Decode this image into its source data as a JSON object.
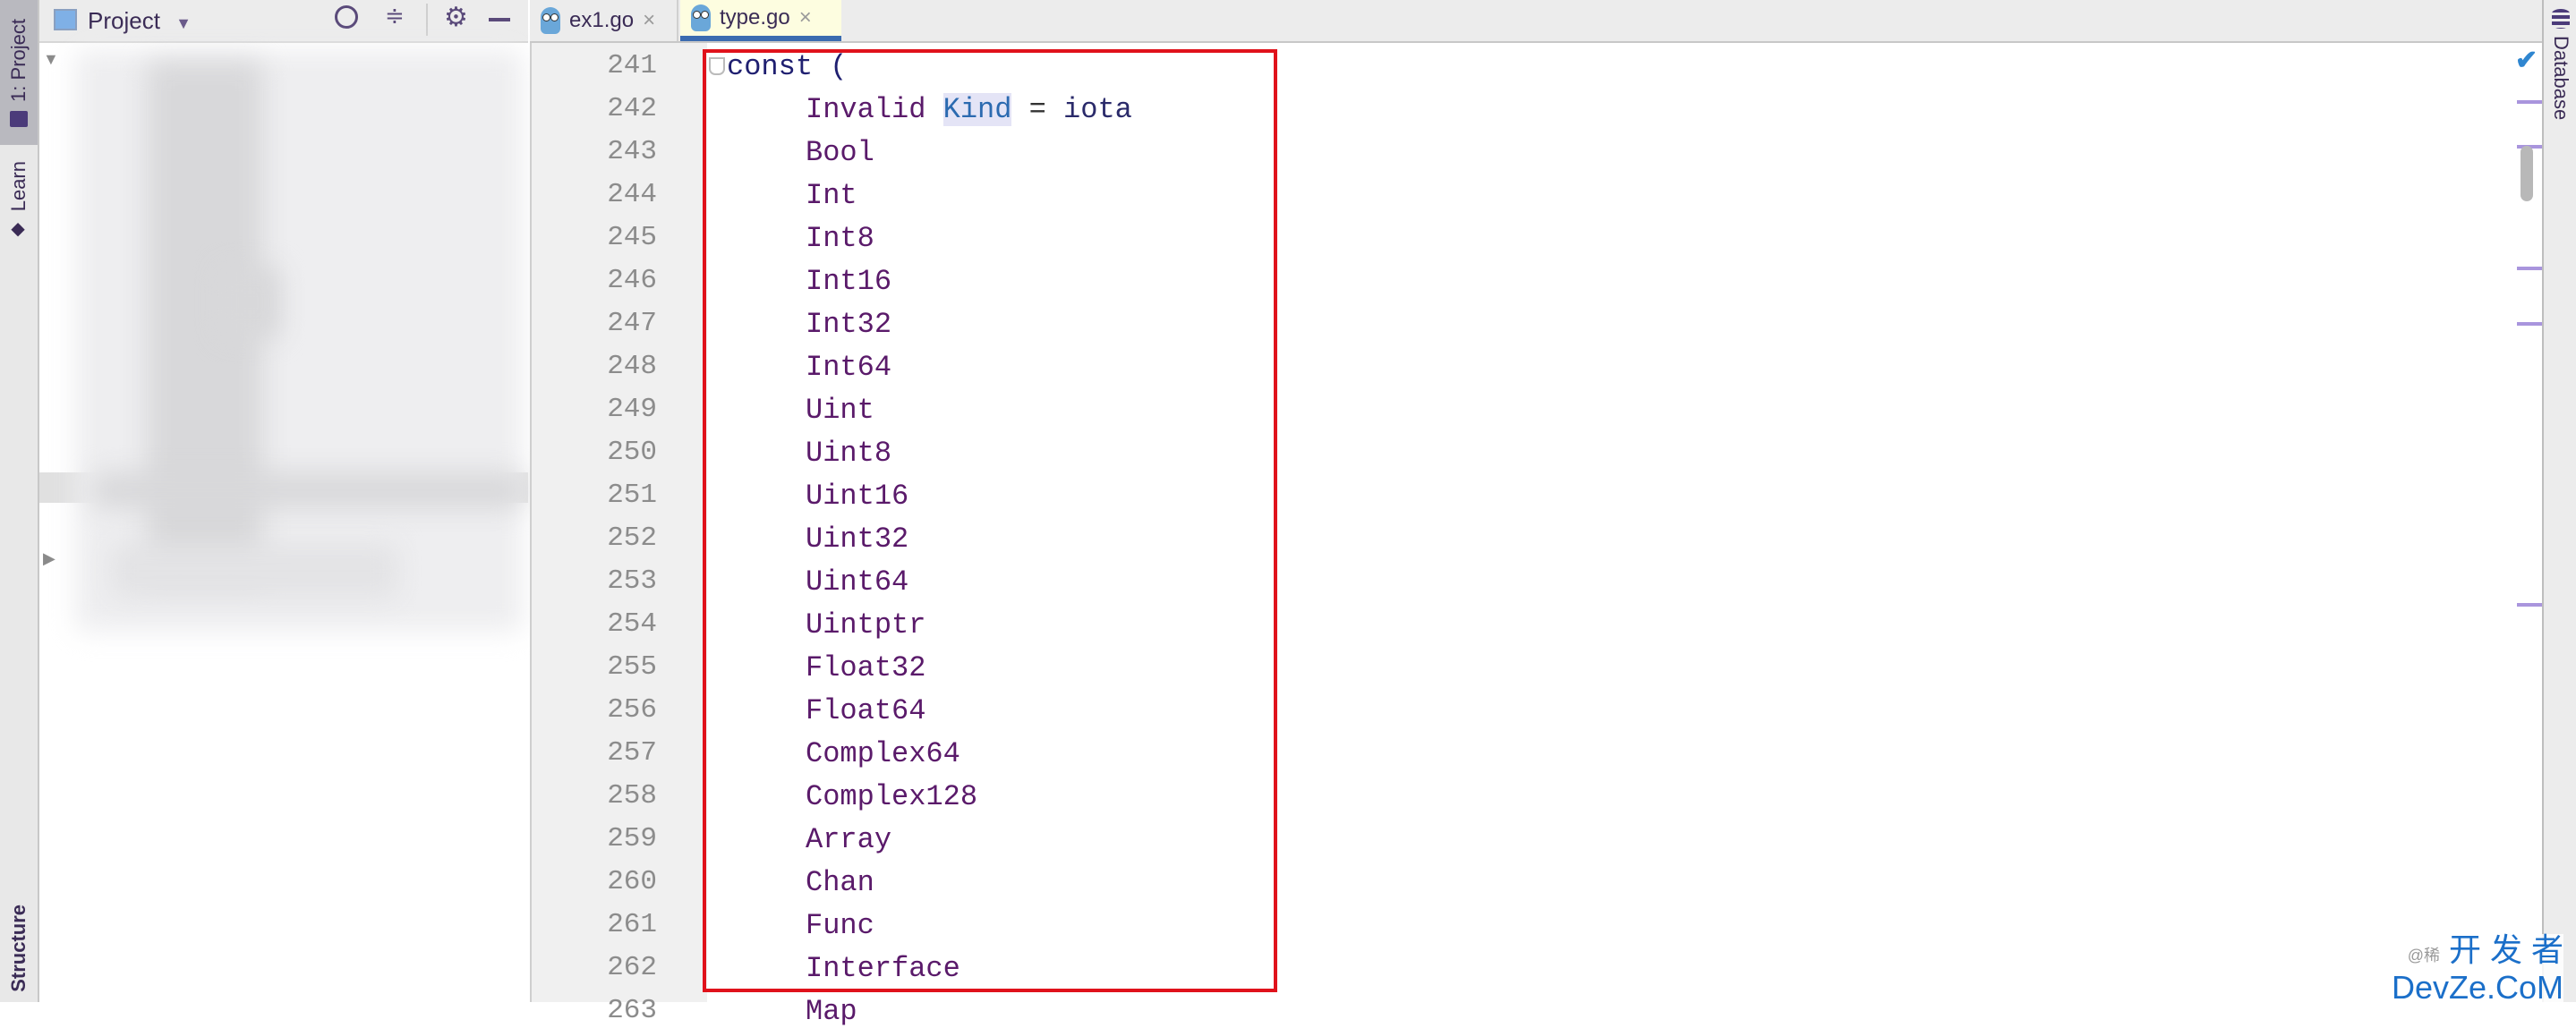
{
  "left_toolstrip": {
    "tabs": [
      {
        "label": "1: Project",
        "icon": "folder-icon",
        "active": true
      },
      {
        "label": "Learn",
        "icon": "graduation-cap-icon",
        "active": false
      },
      {
        "label": "Structure",
        "icon": "",
        "active": false
      }
    ]
  },
  "project_panel": {
    "title": "Project",
    "actions": [
      "locate-icon",
      "collapse-all-icon",
      "gear-icon",
      "minimize-icon"
    ],
    "content_blurred": true
  },
  "editor_tabs": [
    {
      "label": "ex1.go",
      "active": false
    },
    {
      "label": "type.go",
      "active": true
    }
  ],
  "editor": {
    "lines": [
      {
        "no": "241",
        "parts": [
          {
            "t": "const (",
            "c": "kw"
          }
        ],
        "indent": 0,
        "fold": true
      },
      {
        "no": "242",
        "parts": [
          {
            "t": "Invalid ",
            "c": ""
          },
          {
            "t": "Kind",
            "c": "tp"
          },
          {
            "t": " = ",
            "c": "op"
          },
          {
            "t": "iota",
            "c": "id"
          }
        ],
        "indent": 1
      },
      {
        "no": "243",
        "parts": [
          {
            "t": "Bool",
            "c": ""
          }
        ],
        "indent": 1
      },
      {
        "no": "244",
        "parts": [
          {
            "t": "Int",
            "c": ""
          }
        ],
        "indent": 1
      },
      {
        "no": "245",
        "parts": [
          {
            "t": "Int8",
            "c": ""
          }
        ],
        "indent": 1
      },
      {
        "no": "246",
        "parts": [
          {
            "t": "Int16",
            "c": ""
          }
        ],
        "indent": 1
      },
      {
        "no": "247",
        "parts": [
          {
            "t": "Int32",
            "c": ""
          }
        ],
        "indent": 1
      },
      {
        "no": "248",
        "parts": [
          {
            "t": "Int64",
            "c": ""
          }
        ],
        "indent": 1
      },
      {
        "no": "249",
        "parts": [
          {
            "t": "Uint",
            "c": ""
          }
        ],
        "indent": 1
      },
      {
        "no": "250",
        "parts": [
          {
            "t": "Uint8",
            "c": ""
          }
        ],
        "indent": 1
      },
      {
        "no": "251",
        "parts": [
          {
            "t": "Uint16",
            "c": ""
          }
        ],
        "indent": 1
      },
      {
        "no": "252",
        "parts": [
          {
            "t": "Uint32",
            "c": ""
          }
        ],
        "indent": 1
      },
      {
        "no": "253",
        "parts": [
          {
            "t": "Uint64",
            "c": ""
          }
        ],
        "indent": 1
      },
      {
        "no": "254",
        "parts": [
          {
            "t": "Uintptr",
            "c": ""
          }
        ],
        "indent": 1
      },
      {
        "no": "255",
        "parts": [
          {
            "t": "Float32",
            "c": ""
          }
        ],
        "indent": 1
      },
      {
        "no": "256",
        "parts": [
          {
            "t": "Float64",
            "c": ""
          }
        ],
        "indent": 1
      },
      {
        "no": "257",
        "parts": [
          {
            "t": "Complex64",
            "c": ""
          }
        ],
        "indent": 1
      },
      {
        "no": "258",
        "parts": [
          {
            "t": "Complex128",
            "c": ""
          }
        ],
        "indent": 1
      },
      {
        "no": "259",
        "parts": [
          {
            "t": "Array",
            "c": ""
          }
        ],
        "indent": 1
      },
      {
        "no": "260",
        "parts": [
          {
            "t": "Chan",
            "c": ""
          }
        ],
        "indent": 1
      },
      {
        "no": "261",
        "parts": [
          {
            "t": "Func",
            "c": ""
          }
        ],
        "indent": 1
      },
      {
        "no": "262",
        "parts": [
          {
            "t": "Interface",
            "c": ""
          }
        ],
        "indent": 1
      },
      {
        "no": "263",
        "parts": [
          {
            "t": "Map",
            "c": ""
          }
        ],
        "indent": 1
      }
    ],
    "highlight_box_color": "#e0121b",
    "inspection_status": "ok-checkmark"
  },
  "right_toolstrip": {
    "tabs": [
      {
        "label": "Database",
        "icon": "database-icon"
      }
    ]
  },
  "watermark": {
    "line1": "开 发 者",
    "line2": "DevZe.CoM",
    "prefix": "@稀"
  }
}
